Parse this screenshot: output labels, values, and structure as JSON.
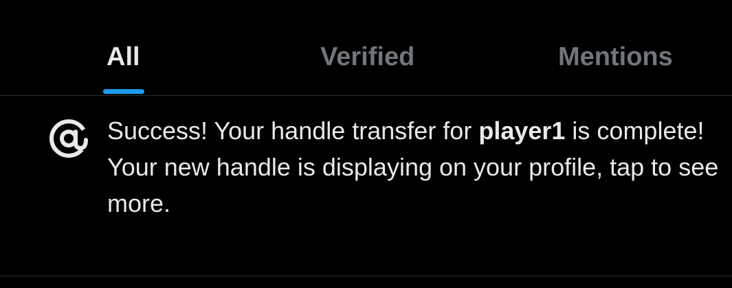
{
  "colors": {
    "background": "#000000",
    "text_primary": "#e7e9ea",
    "text_secondary": "#71767b",
    "accent": "#1d9bf0",
    "divider": "#2f3336"
  },
  "tabs": [
    {
      "label": "All",
      "selected": true
    },
    {
      "label": "Verified",
      "selected": false
    },
    {
      "label": "Mentions",
      "selected": false
    }
  ],
  "notification": {
    "icon": "at-sign-icon",
    "line1_prefix": "Success! Your handle transfer for ",
    "handle": "player1",
    "line1_suffix": " is complete!",
    "line2": "Your new handle is displaying on your profile, tap to see more."
  }
}
